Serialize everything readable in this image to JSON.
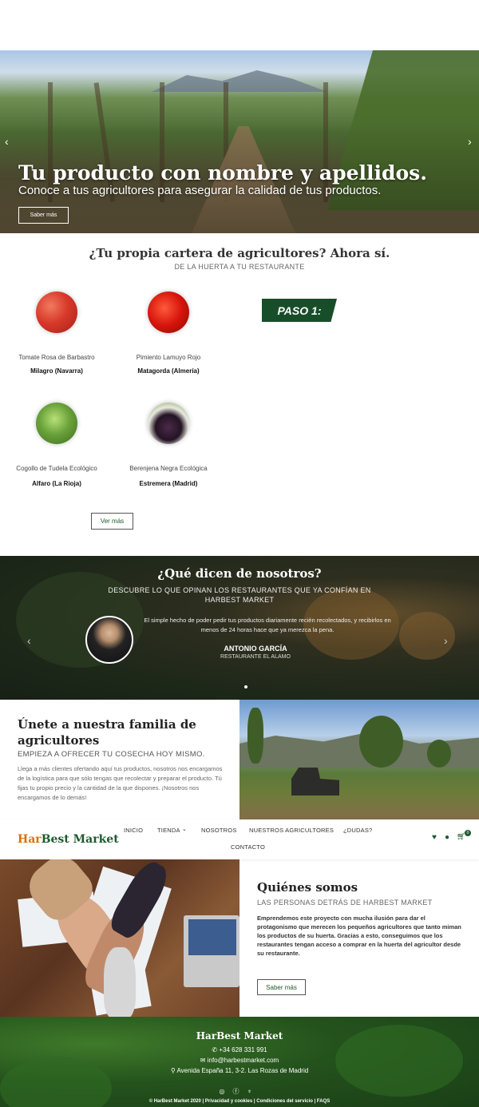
{
  "hero": {
    "title": "Tu producto con nombre y apellidos.",
    "subtitle": "Conoce a tus agricultores para asegurar la calidad de tus productos.",
    "button": "Saber más"
  },
  "cartera": {
    "title": "¿Tu propia cartera de agricultores? Ahora sí.",
    "subtitle": "DE LA HUERTA A TU RESTAURANTE",
    "paso": "PASO 1:",
    "products": [
      {
        "name": "Tomate Rosa de Barbastro",
        "location": "Milagro (Navarra)",
        "icon": "tomato-icon"
      },
      {
        "name": "Pimiento Lamuyo Rojo",
        "location": "Matagorda (Almería)",
        "icon": "pepper-icon"
      },
      {
        "name": "Cogollo de Tudela Ecológico",
        "location": "Alfaro (La Rioja)",
        "icon": "lettuce-icon"
      },
      {
        "name": "Berenjena Negra Ecológica",
        "location": "Estremera (Madrid)",
        "icon": "eggplant-icon"
      }
    ],
    "button": "Ver más"
  },
  "testimonials": {
    "title": "¿Qué dicen de nosotros?",
    "subtitle": "DESCUBRE LO QUE OPINAN LOS RESTAURANTES QUE YA CONFÍAN EN HARBEST MARKET",
    "quote": "El simple hecho de poder pedir tus productos diariamente recién recolectados, y recibirlos en menos de 24 horas hace que ya merezca la pena.",
    "name": "ANTONIO GARCÍA",
    "role": "RESTAURANTE EL ALAMO"
  },
  "unete": {
    "title": "Únete a nuestra familia de agricultores",
    "subtitle": "EMPIEZA A OFRECER TU COSECHA HOY MISMO.",
    "body": "Llega a más clientes ofertando aquí tus productos, nosotros nos encargamos de la logística para que sólo tengas que recolectar y preparar el producto. Tú fijas tu propio precio y la cantidad de la que dispones. ¡Nosotros nos encargamos de lo demás!"
  },
  "nav": {
    "logo_a": "Har",
    "logo_b": "Best Market",
    "items": [
      "INICIO",
      "TIENDA",
      "NOSOTROS",
      "NUESTROS AGRICULTORES",
      "¿DUDAS?",
      "CONTACTO"
    ],
    "cart_count": "0"
  },
  "quienes": {
    "title": "Quiénes somos",
    "subtitle": "LAS PERSONAS DETRÁS DE HARBEST MARKET",
    "body": "Emprendemos este proyecto con mucha ilusión para dar el protagonismo que merecen los  pequeños agricultores que tanto miman los productos de su huerta.  Gracias a esto, conseguimos que los restaurantes tengan acceso a comprar en la huerta del agricultor desde su restaurante.",
    "button": "Saber más"
  },
  "footer": {
    "brand": "HarBest Market",
    "phone": "+34 628 331 991",
    "email": "info@harbestmarket.com",
    "address": "Avenida España 11, 3-2. Las Rozas de Madrid",
    "legal": "© HarBest Market 2020 | Privacidad y cookies | Condiciones del servicio | FAQS"
  }
}
